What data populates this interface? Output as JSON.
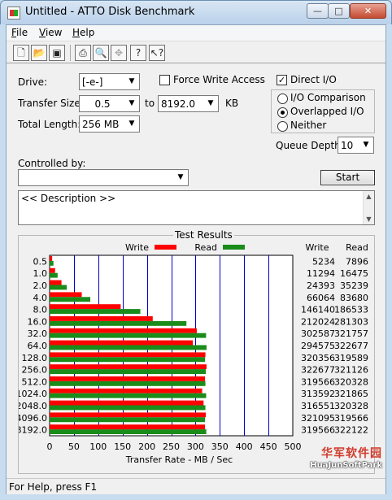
{
  "window": {
    "title": "Untitled - ATTO Disk Benchmark"
  },
  "menu": [
    {
      "key": "F",
      "rest": "ile"
    },
    {
      "key": "V",
      "rest": "iew"
    },
    {
      "key": "H",
      "rest": "elp"
    }
  ],
  "toolbar": [
    "new-icon",
    "open-icon",
    "save-icon",
    "print-icon",
    "print-preview-icon",
    "move-icon",
    "help-icon",
    "context-help-icon"
  ],
  "form": {
    "drive_label": "Drive:",
    "drive_value": "[-e-]",
    "force_write_label": "Force Write Access",
    "force_write_checked": false,
    "direct_io_label": "Direct I/O",
    "direct_io_checked": true,
    "transfer_size_label": "Transfer Size:",
    "transfer_from": "0.5",
    "to_label": "to",
    "transfer_to": "8192.0",
    "kb_label": "KB",
    "total_length_label": "Total Length:",
    "total_length_value": "256 MB",
    "io_comparison_label": "I/O Comparison",
    "overlapped_io_label": "Overlapped I/O",
    "neither_label": "Neither",
    "selected_mode": "Overlapped I/O",
    "queue_depth_label": "Queue Depth:",
    "queue_depth_value": "10",
    "controlled_by_label": "Controlled by:",
    "controlled_by_value": "",
    "start_label": "Start",
    "description": "<< Description >>"
  },
  "results_title": "Test Results",
  "chart_data": {
    "type": "bar",
    "orientation": "horizontal",
    "categories": [
      "0.5",
      "1.0",
      "2.0",
      "4.0",
      "8.0",
      "16.0",
      "32.0",
      "64.0",
      "128.0",
      "256.0",
      "512.0",
      "1024.0",
      "2048.0",
      "4096.0",
      "8192.0"
    ],
    "series": [
      {
        "name": "Write",
        "color": "#ff0000",
        "values": [
          5234,
          11294,
          24393,
          66064,
          146140,
          212024,
          302587,
          294575,
          320356,
          322677,
          319566,
          313592,
          316551,
          321095,
          319566
        ]
      },
      {
        "name": "Read",
        "color": "#1a8c1a",
        "values": [
          7896,
          16475,
          35239,
          83680,
          186533,
          281303,
          321757,
          322677,
          319589,
          321126,
          320328,
          321865,
          320328,
          319566,
          322122
        ]
      }
    ],
    "value_unit_divisor": 1000,
    "xlim": [
      0,
      500
    ],
    "xticks": [
      0,
      50,
      100,
      150,
      200,
      250,
      300,
      350,
      400,
      450,
      500
    ],
    "xlabel": "Transfer Rate - MB / Sec",
    "grid_color": "#0000c8",
    "write_header": "Write",
    "read_header": "Read",
    "legend_placement": "top"
  },
  "status": "For Help, press F1",
  "watermark": {
    "line1": "华军软件园",
    "line2": "HuaJunSoftPark"
  }
}
